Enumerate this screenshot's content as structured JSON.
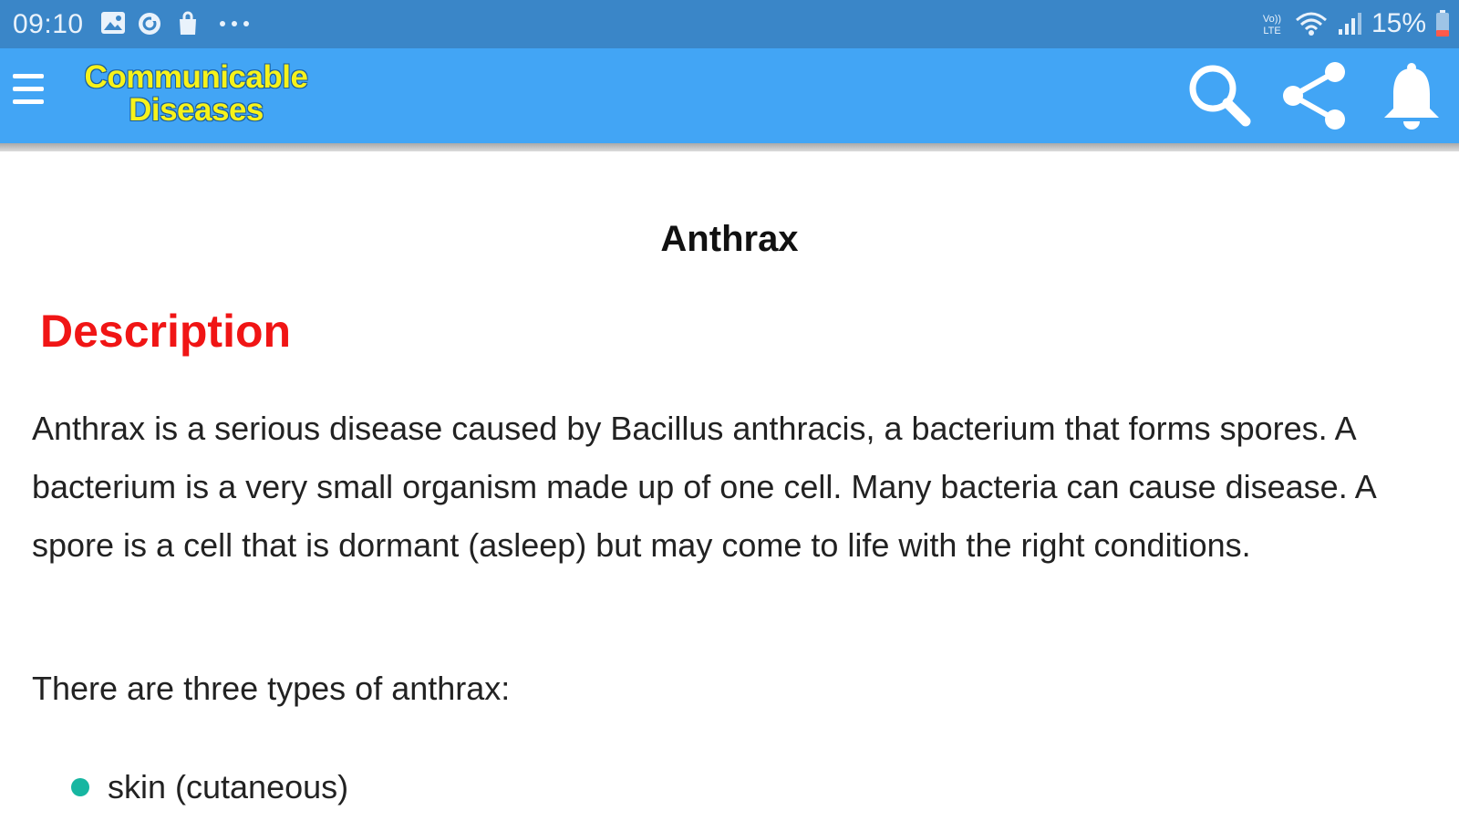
{
  "status_bar": {
    "time": "09:10",
    "left_icons": [
      "gallery-icon",
      "sync-icon",
      "bag-icon",
      "more-dots-icon"
    ],
    "right_icons": [
      "volte-icon",
      "wifi-icon",
      "signal-icon",
      "battery-low-icon"
    ],
    "battery_text": "15%"
  },
  "app_bar": {
    "title_line1": "Communicable",
    "title_line2": "Diseases",
    "actions": [
      "search-icon",
      "share-icon",
      "bell-icon"
    ]
  },
  "content": {
    "title": "Anthrax",
    "section_heading": "Description",
    "paragraph": "Anthrax is a serious disease caused by Bacillus anthracis, a bacterium that forms spores. A bacterium is a very small organism made up of one cell. Many bacteria can cause disease. A spore is a cell that is dormant (asleep) but may come to life with the right conditions.",
    "types_intro": "There are three types of anthrax:",
    "types": [
      "skin (cutaneous)"
    ]
  },
  "colors": {
    "status_bar": "#3a86c8",
    "app_bar": "#42a5f5",
    "brand_text": "#f6f21a",
    "section_heading": "#f01515",
    "bullet": "#17b6a1"
  }
}
